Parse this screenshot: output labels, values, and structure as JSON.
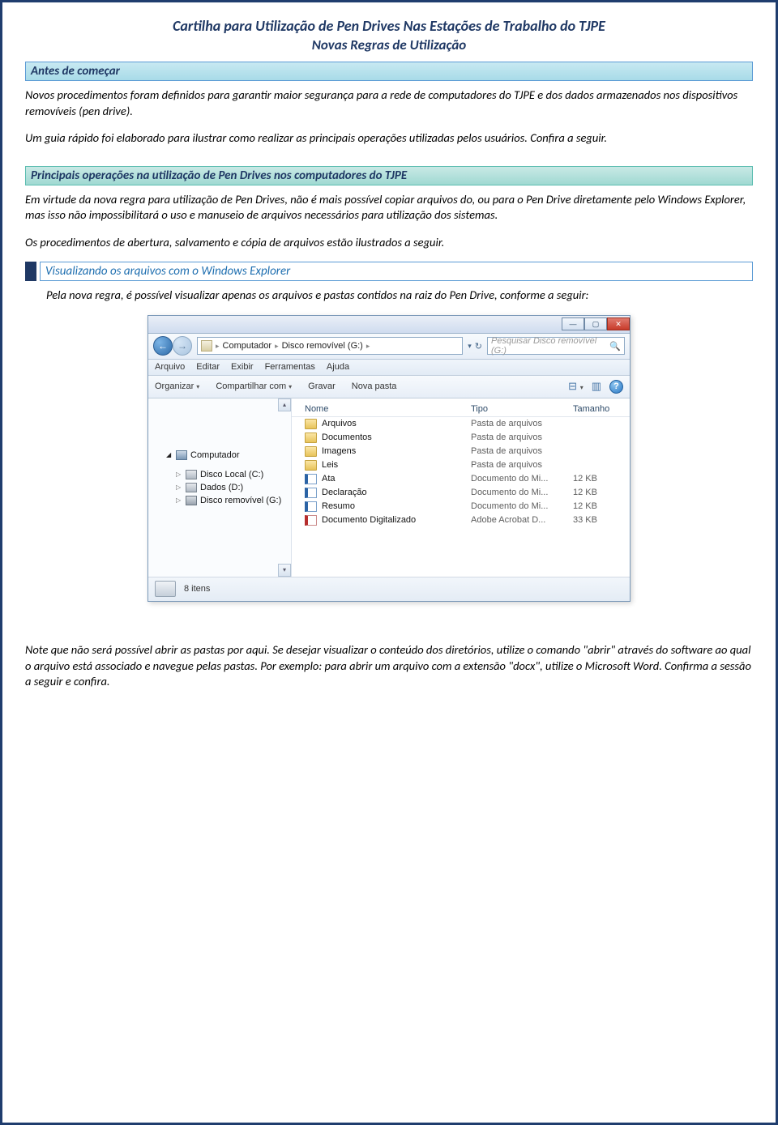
{
  "header": {
    "title": "Cartilha para Utilização de Pen Drives Nas Estações de Trabalho do TJPE",
    "subtitle": "Novas Regras de Utilização"
  },
  "section1": {
    "title": "Antes de começar",
    "p1": "Novos procedimentos foram definidos para garantir maior segurança para a rede de computadores do TJPE e dos dados armazenados nos dispositivos removíveis (pen drive).",
    "p2": "Um guia rápido foi elaborado para ilustrar como realizar as principais operações utilizadas pelos usuários. Confira a seguir."
  },
  "section2": {
    "title": "Principais operações na utilização de Pen Drives nos computadores do TJPE",
    "p1": "Em virtude da nova regra para utilização de Pen Drives, não é mais possível copiar arquivos do, ou para o Pen Drive diretamente pelo Windows Explorer, mas isso não impossibilitará o uso e manuseio de arquivos necessários para utilização dos sistemas.",
    "p2": "Os procedimentos de abertura, salvamento e cópia de arquivos estão ilustrados a seguir."
  },
  "section3": {
    "title": "Visualizando os arquivos com o Windows Explorer",
    "intro": "Pela nova regra, é possível visualizar apenas os arquivos e pastas contidos na raiz do Pen Drive, conforme a seguir:"
  },
  "explorer": {
    "breadcrumb": {
      "a": "Computador",
      "b": "Disco removível (G:)"
    },
    "search_placeholder": "Pesquisar Disco removível (G:)",
    "menu": [
      "Arquivo",
      "Editar",
      "Exibir",
      "Ferramentas",
      "Ajuda"
    ],
    "toolbar": {
      "organizar": "Organizar",
      "compartilhar": "Compartilhar com",
      "gravar": "Gravar",
      "nova_pasta": "Nova pasta"
    },
    "columns": {
      "name": "Nome",
      "type": "Tipo",
      "size": "Tamanho"
    },
    "tree": {
      "computer": "Computador",
      "drives": [
        {
          "label": "Disco Local (C:)"
        },
        {
          "label": "Dados (D:)"
        },
        {
          "label": "Disco removível (G:)"
        }
      ]
    },
    "files": [
      {
        "icon": "folder",
        "name": "Arquivos",
        "type": "Pasta de arquivos",
        "size": ""
      },
      {
        "icon": "folder",
        "name": "Documentos",
        "type": "Pasta de arquivos",
        "size": ""
      },
      {
        "icon": "folder",
        "name": "Imagens",
        "type": "Pasta de arquivos",
        "size": ""
      },
      {
        "icon": "folder",
        "name": "Leis",
        "type": "Pasta de arquivos",
        "size": ""
      },
      {
        "icon": "word",
        "name": "Ata",
        "type": "Documento do Mi...",
        "size": "12 KB"
      },
      {
        "icon": "word",
        "name": "Declaração",
        "type": "Documento do Mi...",
        "size": "12 KB"
      },
      {
        "icon": "word",
        "name": "Resumo",
        "type": "Documento do Mi...",
        "size": "12 KB"
      },
      {
        "icon": "pdf",
        "name": "Documento Digitalizado",
        "type": "Adobe Acrobat D...",
        "size": "33 KB"
      }
    ],
    "status": "8 itens"
  },
  "closing": "Note que não será possível abrir as pastas por aqui. Se desejar visualizar o conteúdo dos diretórios, utilize o comando \"abrir\" através do software ao qual o arquivo está associado e navegue pelas pastas. Por exemplo: para abrir um arquivo com a extensão \"docx\", utilize o Microsoft Word. Confirma a sessão a seguir e confira."
}
